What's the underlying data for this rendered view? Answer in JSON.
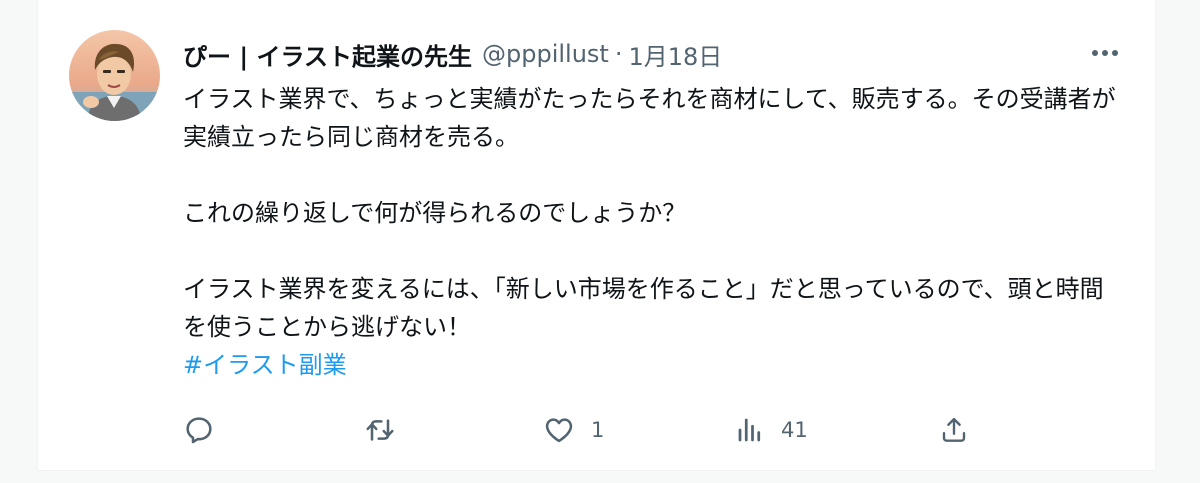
{
  "tweet": {
    "author": {
      "display_name": "ぴー | イラスト起業の先生",
      "handle": "@pppillust",
      "separator": "·",
      "date": "1月18日"
    },
    "paragraphs": [
      "イラスト業界で、ちょっと実績がたったらそれを商材にして、販売する。その受講者が実績立ったら同じ商材を売る。",
      "これの繰り返しで何が得られるのでしょうか？",
      "イラスト業界を変えるには、「新しい市場を作ること」だと思っているので、頭と時間を使うことから逃げない！"
    ],
    "hashtag": "#イラスト副業",
    "actions": {
      "reply": {
        "icon": "reply-icon",
        "count": ""
      },
      "retweet": {
        "icon": "retweet-icon",
        "count": ""
      },
      "like": {
        "icon": "heart-icon",
        "count": "1"
      },
      "views": {
        "icon": "analytics-icon",
        "count": "41"
      },
      "share": {
        "icon": "share-icon",
        "count": ""
      }
    }
  },
  "colors": {
    "text": "#0f1419",
    "secondary": "#536471",
    "link": "#1d9bf0",
    "background": "#f7f9f9"
  }
}
